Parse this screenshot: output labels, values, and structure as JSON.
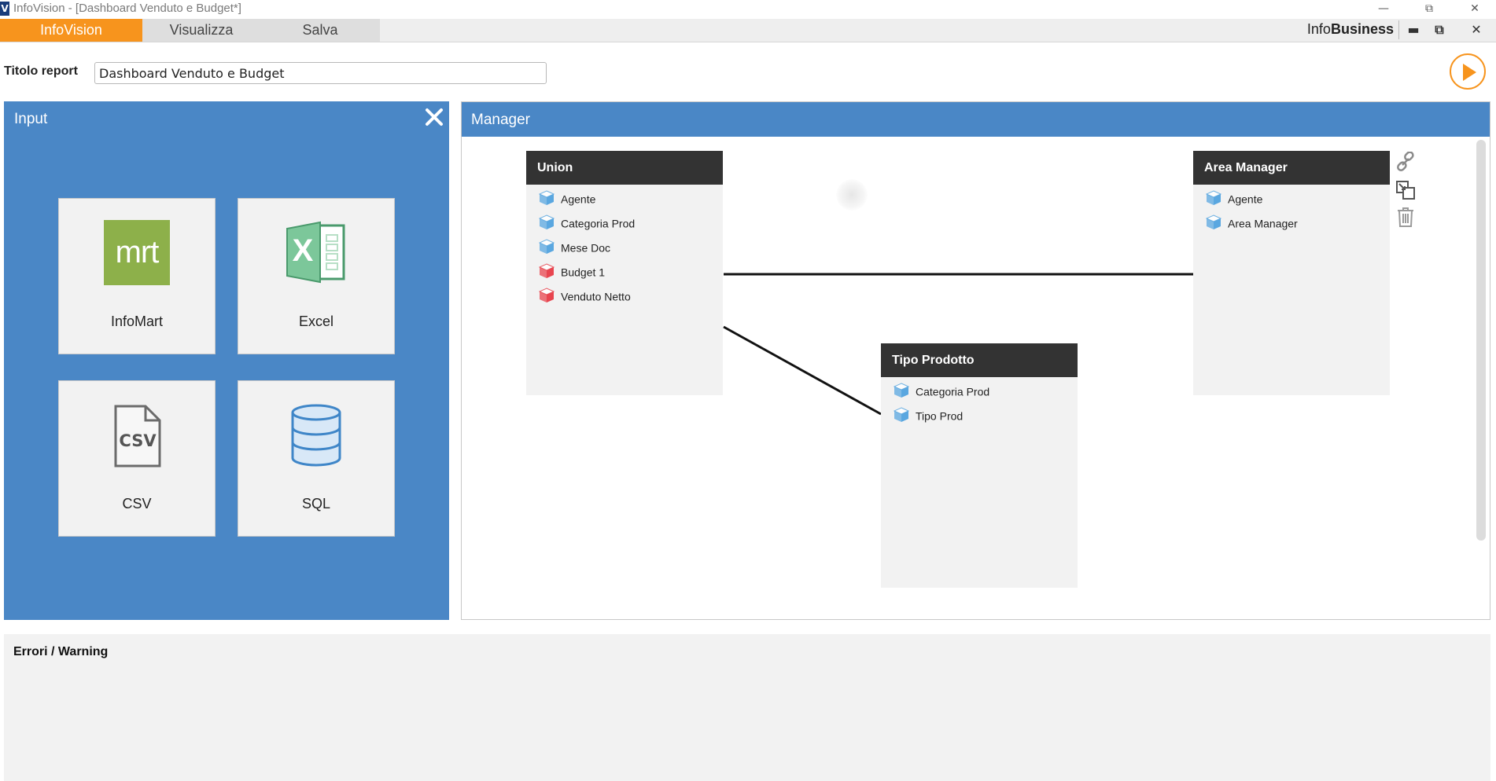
{
  "window": {
    "app_logo": "V",
    "title": "InfoVision - [Dashboard Venduto e Budget*]",
    "minimize_icon": "minimize-icon",
    "restore_icon": "restore-icon",
    "close_icon": "close-icon"
  },
  "ribbon": {
    "tabs": [
      {
        "label": "InfoVision",
        "active": true
      },
      {
        "label": "Visualizza",
        "active": false
      },
      {
        "label": "Salva",
        "active": false
      }
    ],
    "brand_prefix": "Info",
    "brand_bold": "Business"
  },
  "header": {
    "title_label": "Titolo report",
    "title_value": "Dashboard Venduto e Budget",
    "run_icon": "play-icon"
  },
  "input_panel": {
    "title": "Input",
    "close_icon": "close-x-icon",
    "sources": [
      {
        "label": "InfoMart",
        "icon": "infomart-icon",
        "icon_text": "mrt"
      },
      {
        "label": "Excel",
        "icon": "excel-icon",
        "icon_text": "X"
      },
      {
        "label": "CSV",
        "icon": "csv-file-icon",
        "icon_text": "CSV"
      },
      {
        "label": "SQL",
        "icon": "database-icon"
      }
    ]
  },
  "manager_panel": {
    "title": "Manager",
    "nodes": [
      {
        "title": "Union",
        "fields": [
          {
            "label": "Agente",
            "kind": "dimension"
          },
          {
            "label": "Categoria Prod",
            "kind": "dimension"
          },
          {
            "label": "Mese Doc",
            "kind": "dimension"
          },
          {
            "label": "Budget 1",
            "kind": "measure"
          },
          {
            "label": "Venduto Netto",
            "kind": "measure"
          }
        ]
      },
      {
        "title": "Area Manager",
        "fields": [
          {
            "label": "Agente",
            "kind": "dimension"
          },
          {
            "label": "Area Manager",
            "kind": "dimension"
          }
        ]
      },
      {
        "title": "Tipo Prodotto",
        "fields": [
          {
            "label": "Categoria Prod",
            "kind": "dimension"
          },
          {
            "label": "Tipo Prod",
            "kind": "dimension"
          }
        ]
      }
    ],
    "tools": [
      "link-icon",
      "transform-icon",
      "trash-icon"
    ],
    "colors": {
      "dimension": "#5aa7e0",
      "measure": "#e8454f"
    }
  },
  "errors_panel": {
    "title": "Errori / Warning"
  },
  "colors": {
    "accent_orange": "#f7941d",
    "panel_blue": "#4a87c6",
    "node_header": "#333333"
  }
}
